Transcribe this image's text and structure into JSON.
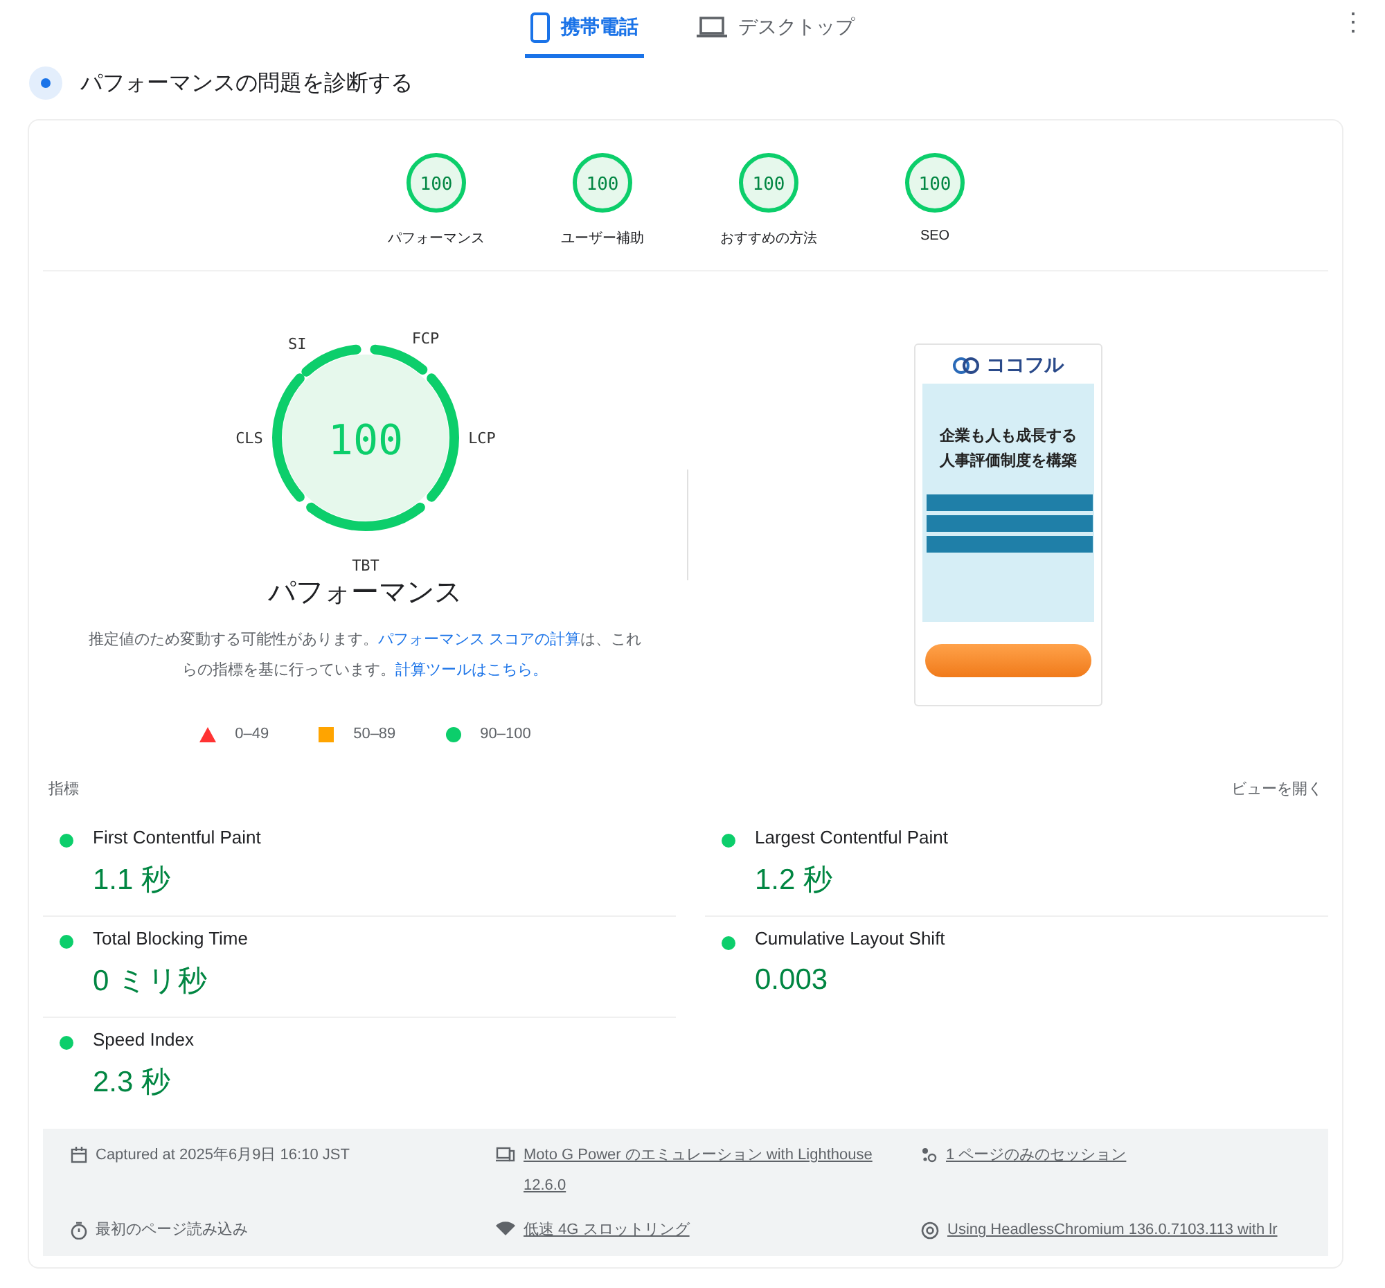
{
  "tabs": [
    {
      "label": "携帯電話",
      "selected": true
    },
    {
      "label": "デスクトップ",
      "selected": false
    }
  ],
  "menu_icon": "⋮",
  "heading": "パフォーマンスの問題を診断する",
  "categories": [
    {
      "score": "100",
      "label": "パフォーマンス",
      "level": 1
    },
    {
      "score": "100",
      "label": "ユーザー補助",
      "level": 1
    },
    {
      "score": "100",
      "label": "おすすめの方法",
      "level": 1
    },
    {
      "score": "100",
      "label": "SEO",
      "level": 1
    }
  ],
  "gauge": {
    "score": "100",
    "title": "パフォーマンス",
    "segments": [
      "SI",
      "FCP",
      "LCP",
      "TBT",
      "CLS"
    ],
    "note_parts": [
      {
        "text": "推定値のため変動する可能性があります。",
        "link": false
      },
      {
        "text": "パフォーマンス スコアの計算",
        "link": true
      },
      {
        "text": "は、これらの指標を基に行っています。",
        "link": false
      },
      {
        "text": "計算ツールはこちら。",
        "link": true
      }
    ]
  },
  "legend": [
    {
      "kind": "triangle",
      "label": "0–49",
      "color": "#ff3333"
    },
    {
      "kind": "square",
      "label": "50–89",
      "color": "#ffa400"
    },
    {
      "kind": "circle",
      "label": "90–100",
      "color": "#0cce6b"
    }
  ],
  "screenshot": {
    "logo": "ココフル",
    "headline": [
      "企業も人も成長する",
      "人事評価制度を構築"
    ]
  },
  "metrics_header": {
    "title": "指標",
    "toggle": "ビューを開く"
  },
  "metrics": [
    {
      "name": "First Contentful Paint",
      "value": "1.1 秒",
      "color": "#0cce6b"
    },
    {
      "name": "Largest Contentful Paint",
      "value": "1.2 秒",
      "color": "#0cce6b"
    },
    {
      "name": "Total Blocking Time",
      "value": "0 ミリ秒",
      "color": "#0cce6b"
    },
    {
      "name": "Cumulative Layout Shift",
      "value": "0.003",
      "color": "#0cce6b"
    },
    {
      "name": "Speed Index",
      "value": "2.3 秒",
      "color": "#0cce6b"
    }
  ],
  "footer": [
    {
      "text": "Captured at 2025年6月9日 16:10 JST",
      "link": false
    },
    {
      "text": "Moto G Power のエミュレーション with Lighthouse 12.6.0",
      "link": true
    },
    {
      "text": "1 ページのみのセッション",
      "link": true
    },
    {
      "text": "最初のページ読み込み",
      "link": false
    },
    {
      "text": "低速 4G スロットリング",
      "link": true
    },
    {
      "text": "Using HeadlessChromium 136.0.7103.113 with lr",
      "link": true
    }
  ]
}
